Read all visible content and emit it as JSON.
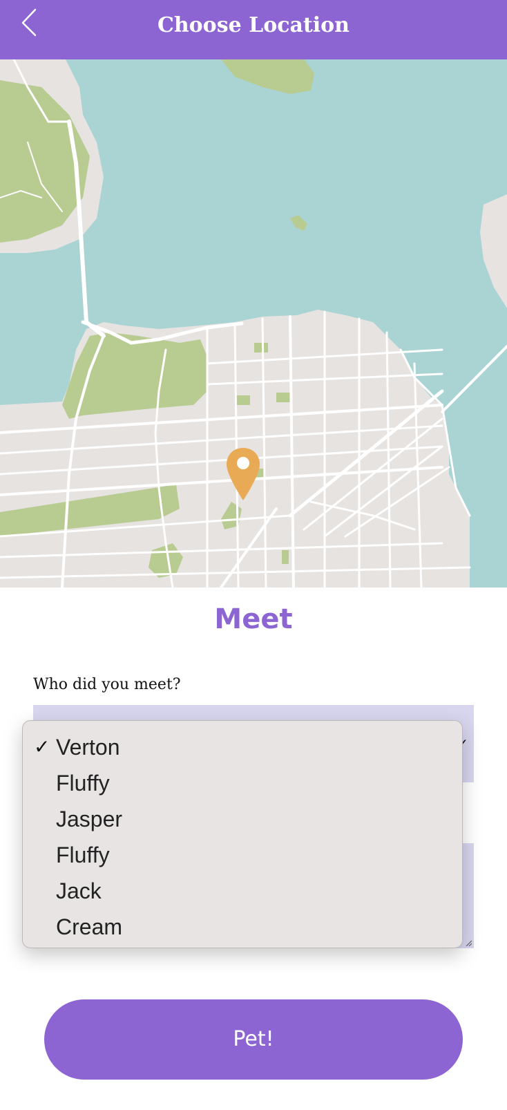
{
  "header": {
    "title": "Choose Location",
    "back_icon": "chevron-left-icon"
  },
  "map": {
    "marker_icon": "map-pin-icon",
    "colors": {
      "water": "#aad3d3",
      "land": "#e6e3e1",
      "park": "#b8cc92",
      "road": "#ffffff",
      "marker": "#e8aa55"
    }
  },
  "form": {
    "section_title": "Meet",
    "who_label": "Who did you meet?",
    "selected_pet": "Verton",
    "options": [
      "Verton",
      "Fluffy",
      "Jasper",
      "Fluffy",
      "Jack",
      "Cream"
    ],
    "selected_index": 0,
    "submit_label": "Pet!"
  },
  "colors": {
    "accent": "#8c65d3",
    "field_bg": "#d7d6ee",
    "dropdown_bg": "#e8e4e4"
  }
}
